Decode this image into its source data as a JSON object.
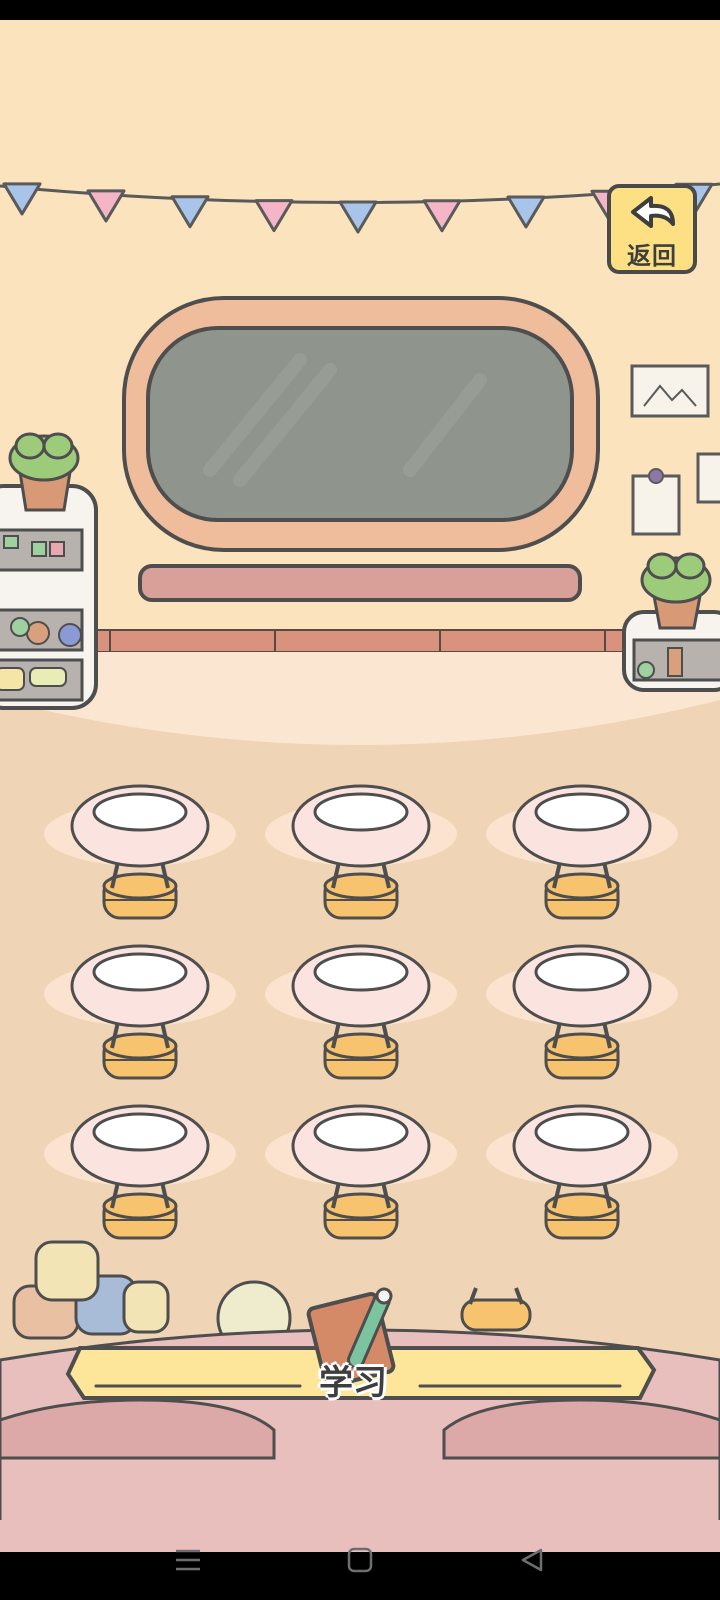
{
  "header": {
    "back_label": "返回"
  },
  "icons": {
    "back": "back-arrow-icon",
    "study": "notebook-pencil-icon",
    "nav_menu": "menu-lines-icon",
    "nav_home": "square-home-icon",
    "nav_back": "triangle-back-icon"
  },
  "classroom": {
    "desks_rows": 3,
    "desks_cols": 3,
    "bunting_colors": [
      "#a8c4e8",
      "#f4b6c6"
    ]
  },
  "study_bar": {
    "label": "学习"
  },
  "colors": {
    "wall": "#fbe3bd",
    "floor": "#f0d4b6",
    "chalkboard": "#8f958d",
    "board_frame": "#efbd9c",
    "desk_top": "#fbe3df",
    "stool": "#f8c36e",
    "sofa": "#e8bfbd",
    "bar": "#fde69a"
  }
}
